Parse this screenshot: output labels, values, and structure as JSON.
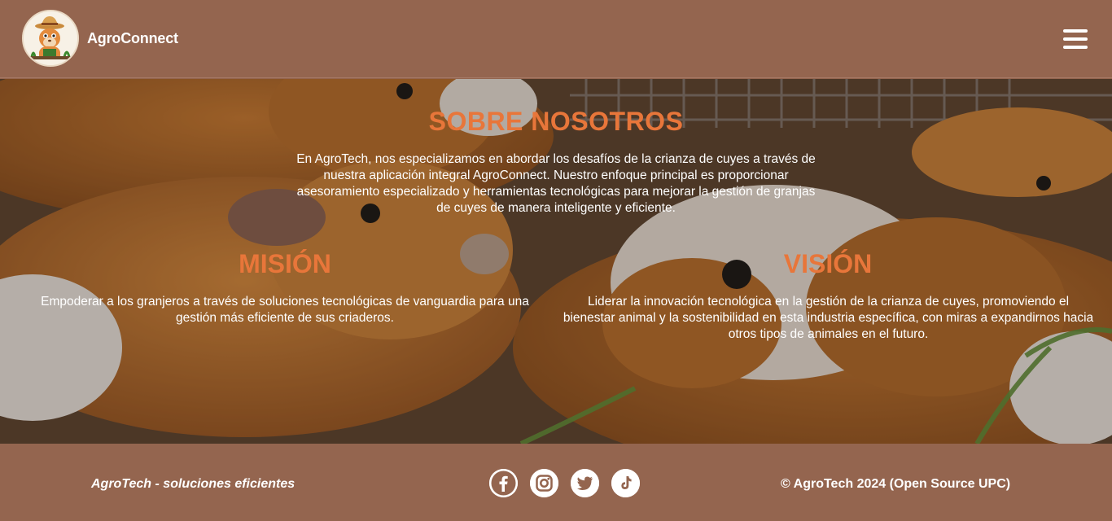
{
  "header": {
    "brand": "AgroConnect",
    "logo_icon": "guinea-pig-farmer-logo",
    "menu_icon": "hamburger-menu-icon",
    "background": "#94654f"
  },
  "about": {
    "title": "SOBRE NOSOTROS",
    "text": "En AgroTech, nos especializamos en abordar los desafíos de la crianza de cuyes a través de nuestra aplicación integral AgroConnect. Nuestro enfoque principal es proporcionar asesoramiento especializado y herramientas tecnológicas para mejorar la gestión de granjas de cuyes de manera inteligente y eficiente."
  },
  "mision": {
    "title": "MISIÓN",
    "text": "Empoderar a los granjeros a través de soluciones tecnológicas de vanguardia para una gestión más eficiente de sus criaderos."
  },
  "vision": {
    "title": "VISIÓN",
    "text": "Liderar la innovación tecnológica en la gestión de la crianza de cuyes, promoviendo el bienestar animal y la sostenibilidad en esta industria específica, con miras a expandirnos hacia otros tipos de animales en el futuro."
  },
  "footer": {
    "tagline": "AgroTech - soluciones eficientes",
    "copyright": "© AgroTech 2024 (Open Source UPC)",
    "social": [
      "facebook-icon",
      "instagram-icon",
      "twitter-icon",
      "tiktok-icon"
    ]
  },
  "colors": {
    "accent": "#e8763a",
    "brown": "#94654f",
    "text": "#ffffff"
  }
}
